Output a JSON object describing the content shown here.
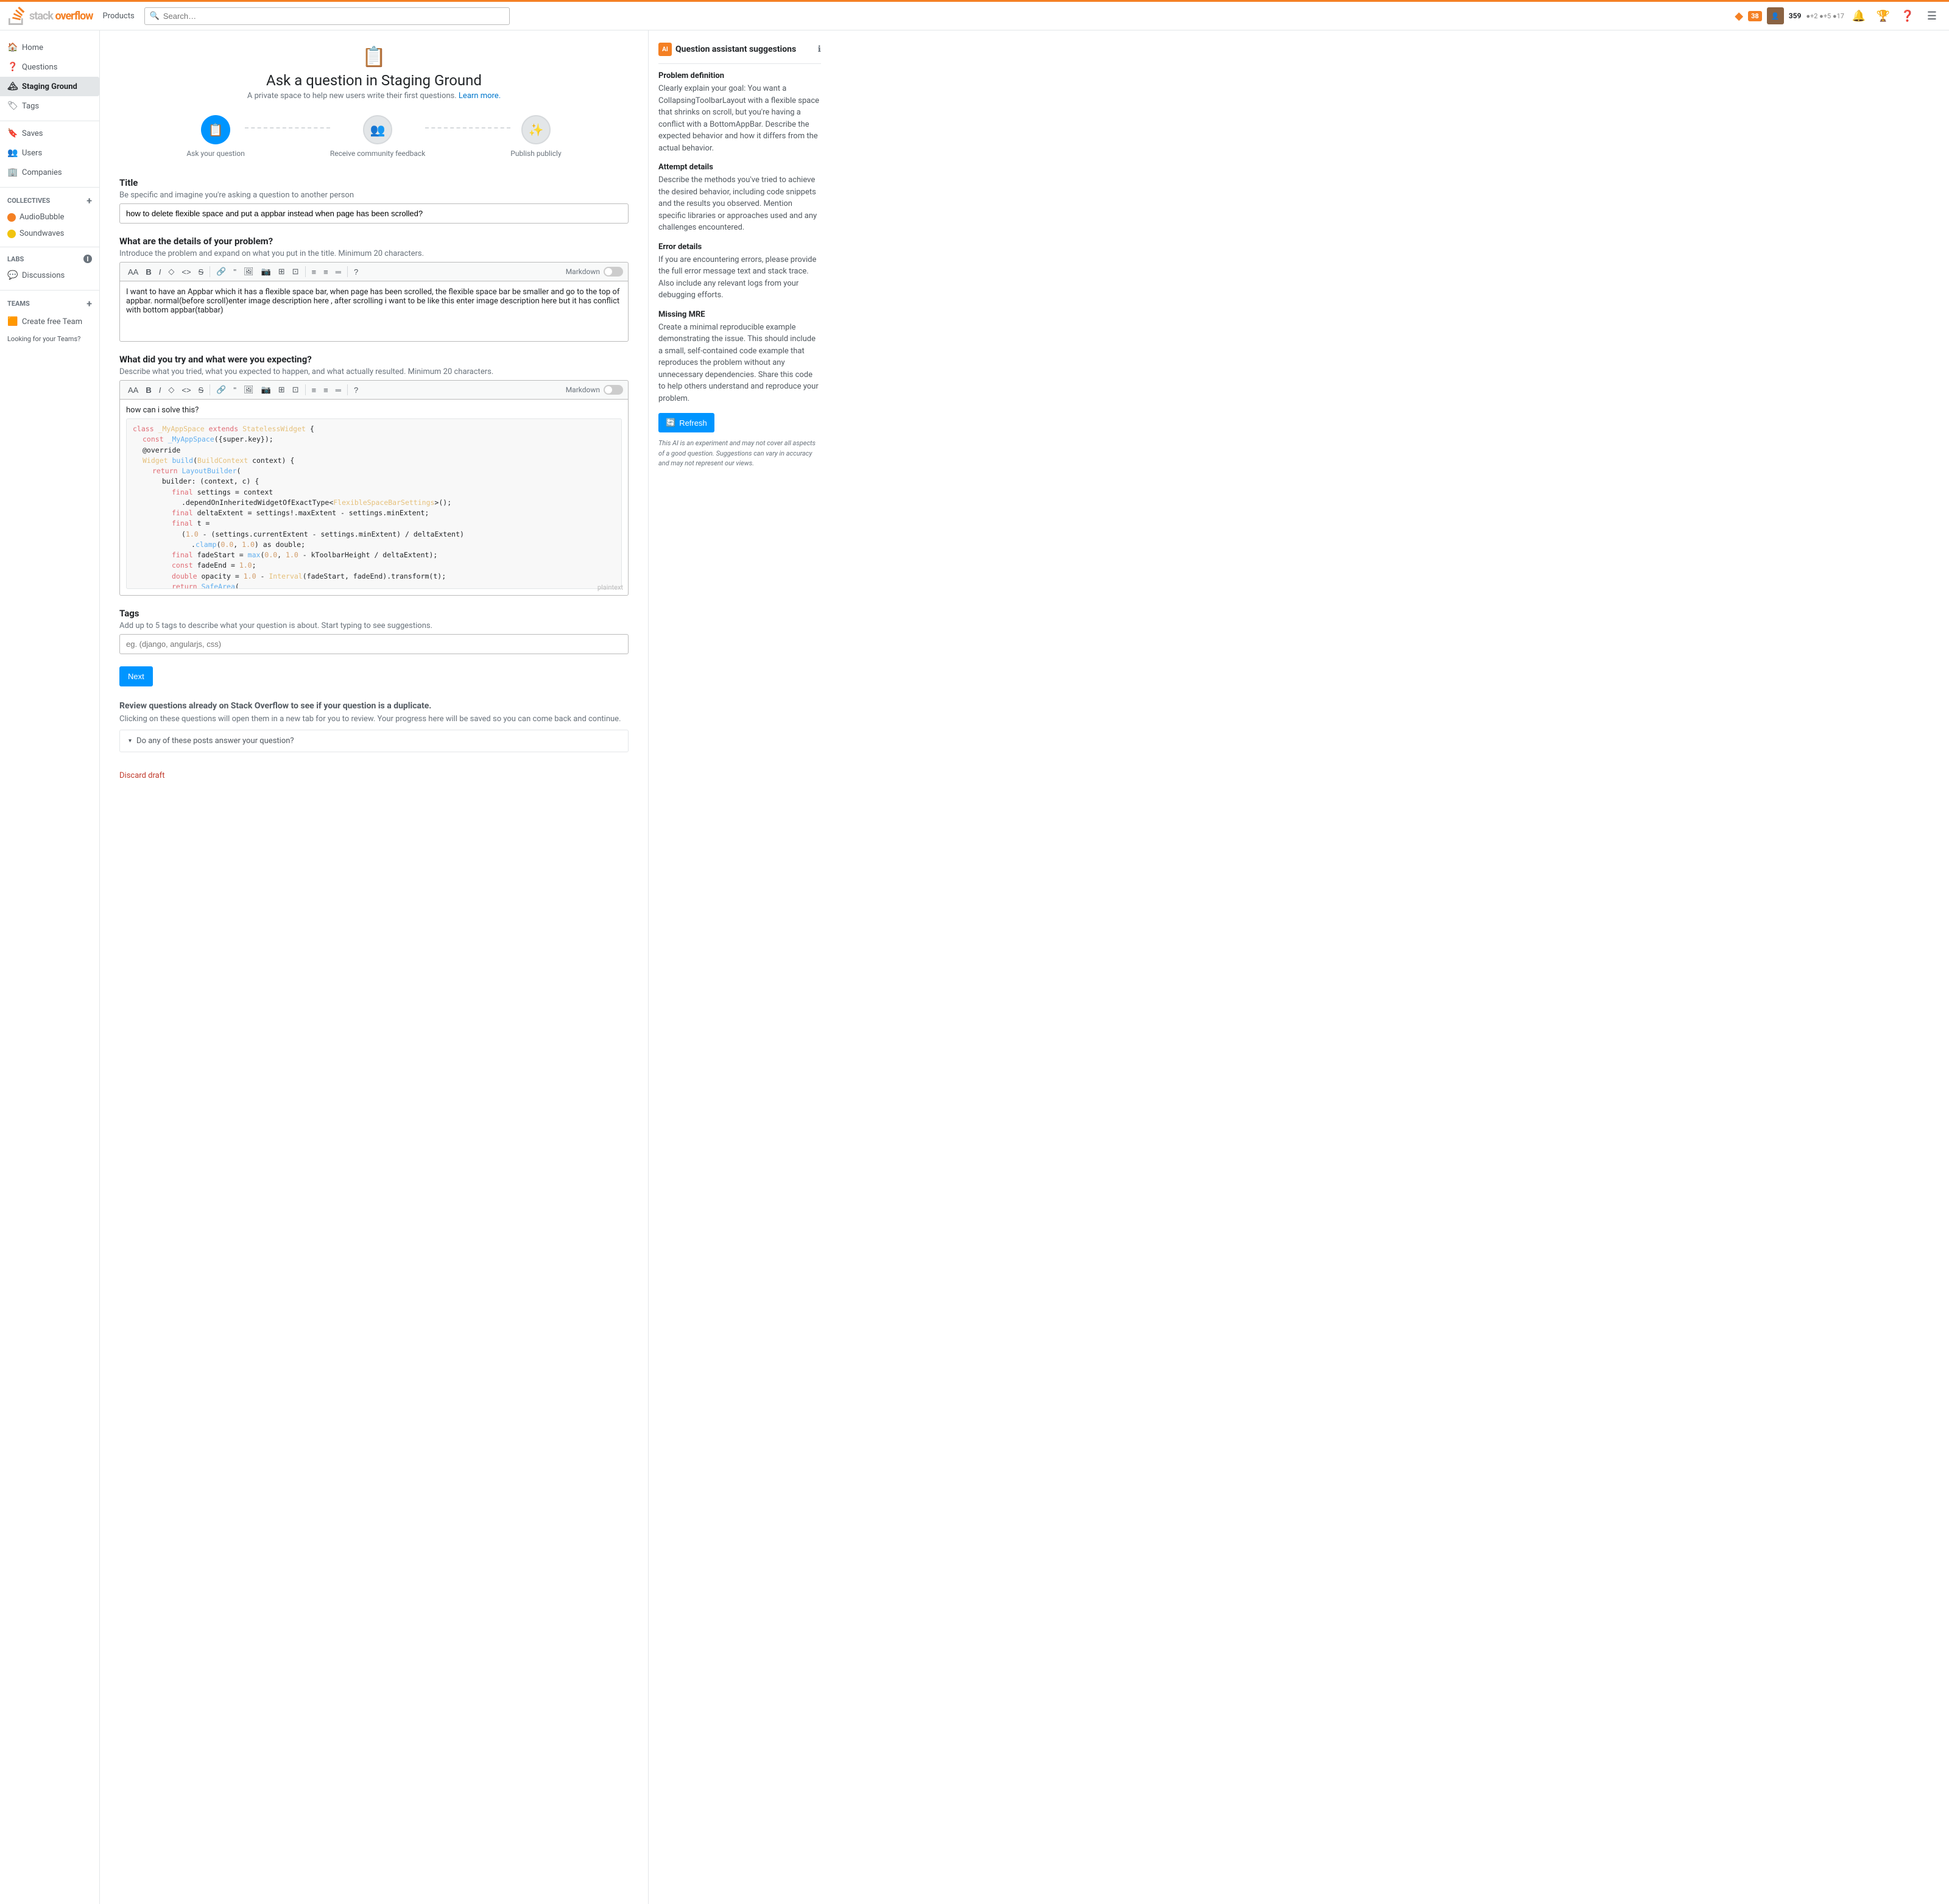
{
  "topnav": {
    "logo_text": "stack overflow",
    "products_label": "Products",
    "search_placeholder": "Search…",
    "reputation": "359",
    "rep_badge1": "+2",
    "rep_badge2": "+5",
    "rep_badge3": "17",
    "notification_count": "38"
  },
  "sidebar": {
    "items": [
      {
        "label": "Home",
        "icon": "🏠",
        "active": false
      },
      {
        "label": "Questions",
        "icon": "❓",
        "active": false
      },
      {
        "label": "Staging Ground",
        "icon": "🏔",
        "active": true
      },
      {
        "label": "Tags",
        "icon": "🏷",
        "active": false
      }
    ],
    "saves_label": "Saves",
    "users_label": "Users",
    "companies_label": "Companies",
    "collectives_header": "COLLECTIVES",
    "collectives": [
      {
        "label": "AudioBubble",
        "color": "#f48024"
      },
      {
        "label": "Soundwaves",
        "color": "#f1c40f"
      }
    ],
    "labs_header": "LABS",
    "discussions_label": "Discussions",
    "teams_header": "TEAMS",
    "create_team_label": "Create free Team",
    "looking_for_teams": "Looking for your Teams?"
  },
  "page": {
    "icon": "📋",
    "title": "Ask a question in Staging Ground",
    "subtitle": "A private space to help new users write their first questions.",
    "learn_more": "Learn more."
  },
  "stepper": {
    "step1_label": "Ask your question",
    "step2_label": "Receive community feedback",
    "step3_label": "Publish publicly"
  },
  "form": {
    "title_label": "Title",
    "title_hint": "Be specific and imagine you're asking a question to another person",
    "title_value": "how to delete flexible space and put a appbar instead when page has been scrolled?",
    "details_label": "What are the details of your problem?",
    "details_hint": "Introduce the problem and expand on what you put in the title. Minimum 20 characters.",
    "details_text": "I want to have an Appbar which it has a flexible space bar, when page has been scrolled, the flexible space bar be smaller and go to the top of appbar.\nnormal(before scroll)enter image description here , after scrolling i want to be like this enter image description here but it has conflict with bottom appbar(tabbar)",
    "tried_label": "What did you try and what were you expecting?",
    "tried_hint": "Describe what you tried, what you expected to happen, and what actually resulted. Minimum 20 characters.",
    "tried_text": "how can i solve this?",
    "tags_label": "Tags",
    "tags_hint": "Add up to 5 tags to describe what your question is about. Start typing to see suggestions.",
    "tags_placeholder": "eg. (django, angularjs, css)",
    "next_btn": "Next",
    "markdown_label": "Markdown",
    "plaintext_label": "plaintext"
  },
  "toolbar": {
    "btns": [
      "AA",
      "B",
      "I",
      "◇",
      "<>",
      "S",
      "🔗",
      "\"",
      "🖼",
      "📷",
      "⊞",
      "⊡",
      "≡",
      "≡",
      "═",
      "?"
    ]
  },
  "duplicate": {
    "title": "Review questions already on Stack Overflow to see if your question is a duplicate.",
    "hint": "Clicking on these questions will open them in a new tab for you to review. Your progress here will be saved so you can come back and continue.",
    "accordion_label": "Do any of these posts answer your question?",
    "discard_label": "Discard draft"
  },
  "assistant": {
    "title": "Question assistant suggestions",
    "sections": [
      {
        "title": "Problem definition",
        "text": "Clearly explain your goal: You want a CollapsingToolbarLayout with a flexible space that shrinks on scroll, but you're having a conflict with a BottomAppBar. Describe the expected behavior and how it differs from the actual behavior."
      },
      {
        "title": "Attempt details",
        "text": "Describe the methods you've tried to achieve the desired behavior, including code snippets and the results you observed. Mention specific libraries or approaches used and any challenges encountered."
      },
      {
        "title": "Error details",
        "text": "If you are encountering errors, please provide the full error message text and stack trace. Also include any relevant logs from your debugging efforts."
      },
      {
        "title": "Missing MRE",
        "text": "Create a minimal reproducible example demonstrating the issue. This should include a small, self-contained code example that reproduces the problem without any unnecessary dependencies. Share this code to help others understand and reproduce your problem."
      }
    ],
    "refresh_btn": "Refresh",
    "disclaimer": "This AI is an experiment and may not cover all aspects of a good question. Suggestions can vary in accuracy and may not represent our views."
  }
}
